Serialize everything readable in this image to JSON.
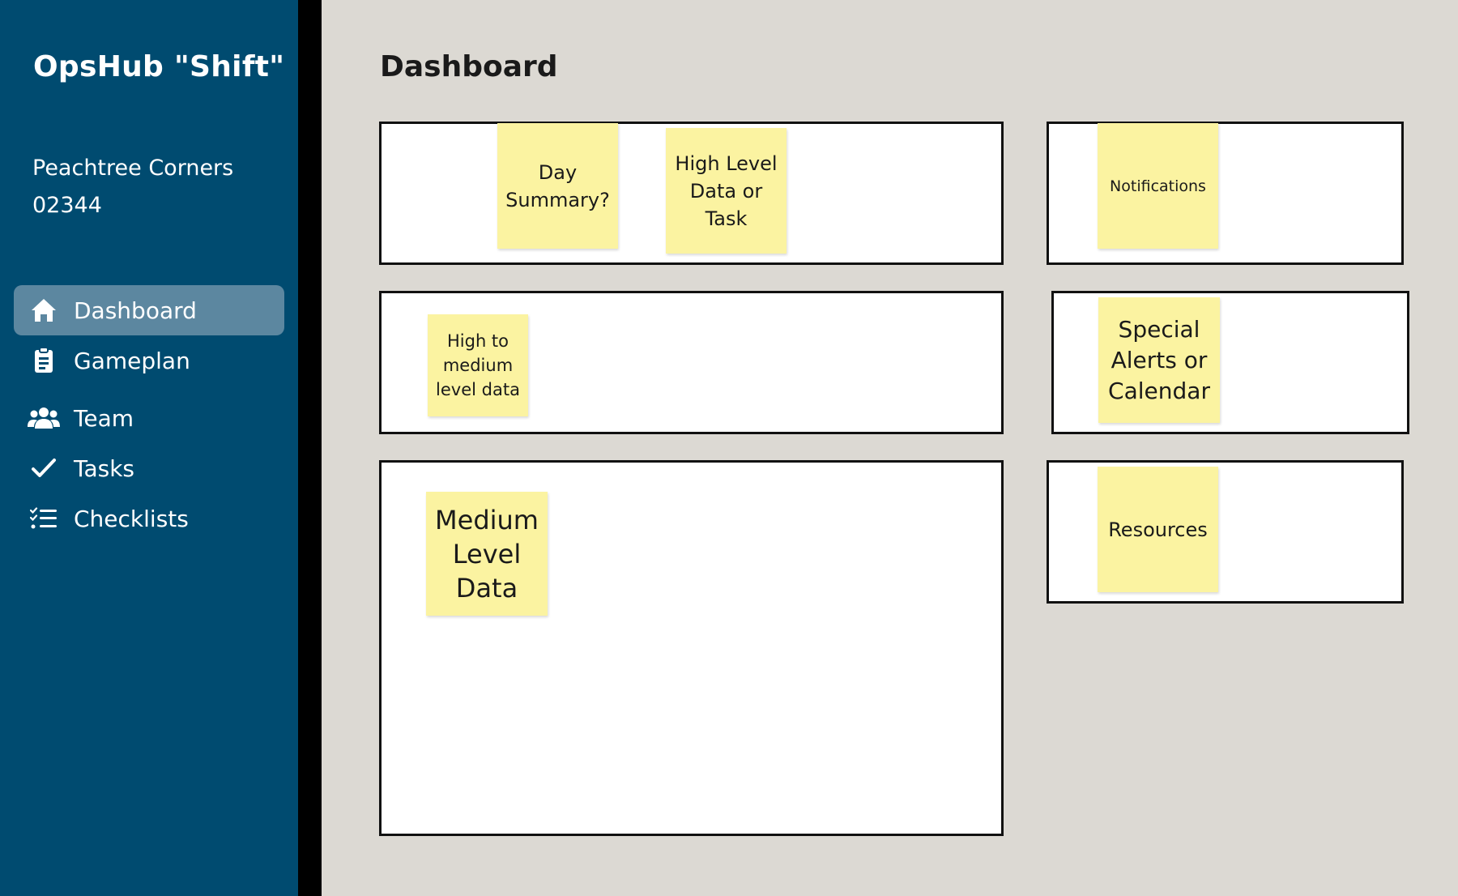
{
  "app": {
    "title": "OpsHub \"Shift\"",
    "location_line1": "Peachtree Corners",
    "location_line2": "02344"
  },
  "nav": {
    "items": [
      {
        "label": "Dashboard",
        "icon": "home-icon",
        "active": true
      },
      {
        "label": "Gameplan",
        "icon": "clipboard-icon",
        "active": false
      },
      {
        "label": "Team",
        "icon": "team-icon",
        "active": false
      },
      {
        "label": "Tasks",
        "icon": "check-icon",
        "active": false
      },
      {
        "label": "Checklists",
        "icon": "checklist-icon",
        "active": false
      }
    ]
  },
  "main": {
    "title": "Dashboard",
    "stickies": {
      "day_summary": "Day Summary?",
      "high_level": "High Level Data or Task",
      "notifications": "Notifications",
      "high_to_medium": "High to medium level data",
      "special_alerts": "Special Alerts or Calendar",
      "medium_level": "Medium Level Data",
      "resources": "Resources"
    }
  },
  "colors": {
    "sidebar": "#004b70",
    "active_nav": "#5c87a0",
    "background": "#dcd9d3",
    "sticky": "#fbf3a1"
  }
}
